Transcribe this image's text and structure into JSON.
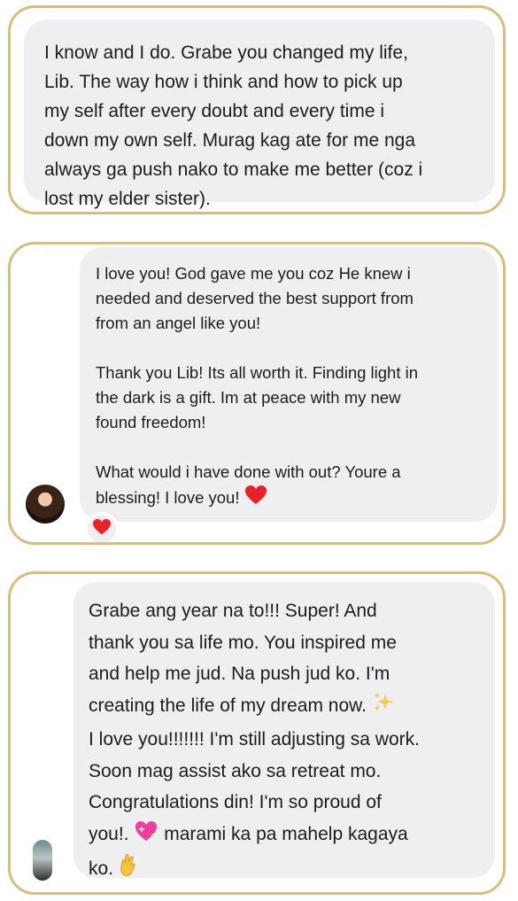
{
  "messages": [
    {
      "text": "I know and I do. Grabe you changed my life,\nLib. The way how i think and how to pick up\nmy self after every doubt and every time i\ndown my own self. Murag kag ate for me nga\nalways ga push nako to make me better (coz i\nlost my elder sister)."
    },
    {
      "paragraphs": [
        "I love you! God gave me you coz He knew i\nneeded and deserved the best support from\nfrom an angel like you!",
        "Thank you Lib! Its all worth it. Finding light in\nthe dark is a gift.  Im at peace with my new\nfound freedom!",
        "What would i have done with out? Youre a\nblessing! I love you!"
      ],
      "inline_emoji": "heart-emoji",
      "reaction": "heart-emoji"
    },
    {
      "lines": [
        "Grabe ang year na to!!! Super! And",
        "thank you sa life mo. You inspired me",
        "and help me jud. Na push jud ko. I'm",
        "creating the life of my dream now.",
        "I love you!!!!!!! I'm still adjusting sa work.",
        "Soon mag assist ako sa retreat mo.",
        "Congratulations din! I'm so proud of",
        "you!.",
        "marami ka pa mahelp kagaya",
        "ko."
      ],
      "emojis": [
        "sparkles-emoji",
        "sparkling-heart-emoji",
        "pinching-hand-emoji"
      ]
    }
  ],
  "colors": {
    "card_border": "#d8bd7f",
    "bubble_bg": "#efeff2",
    "text": "#1c1c1e",
    "heart": "#e8212b"
  }
}
